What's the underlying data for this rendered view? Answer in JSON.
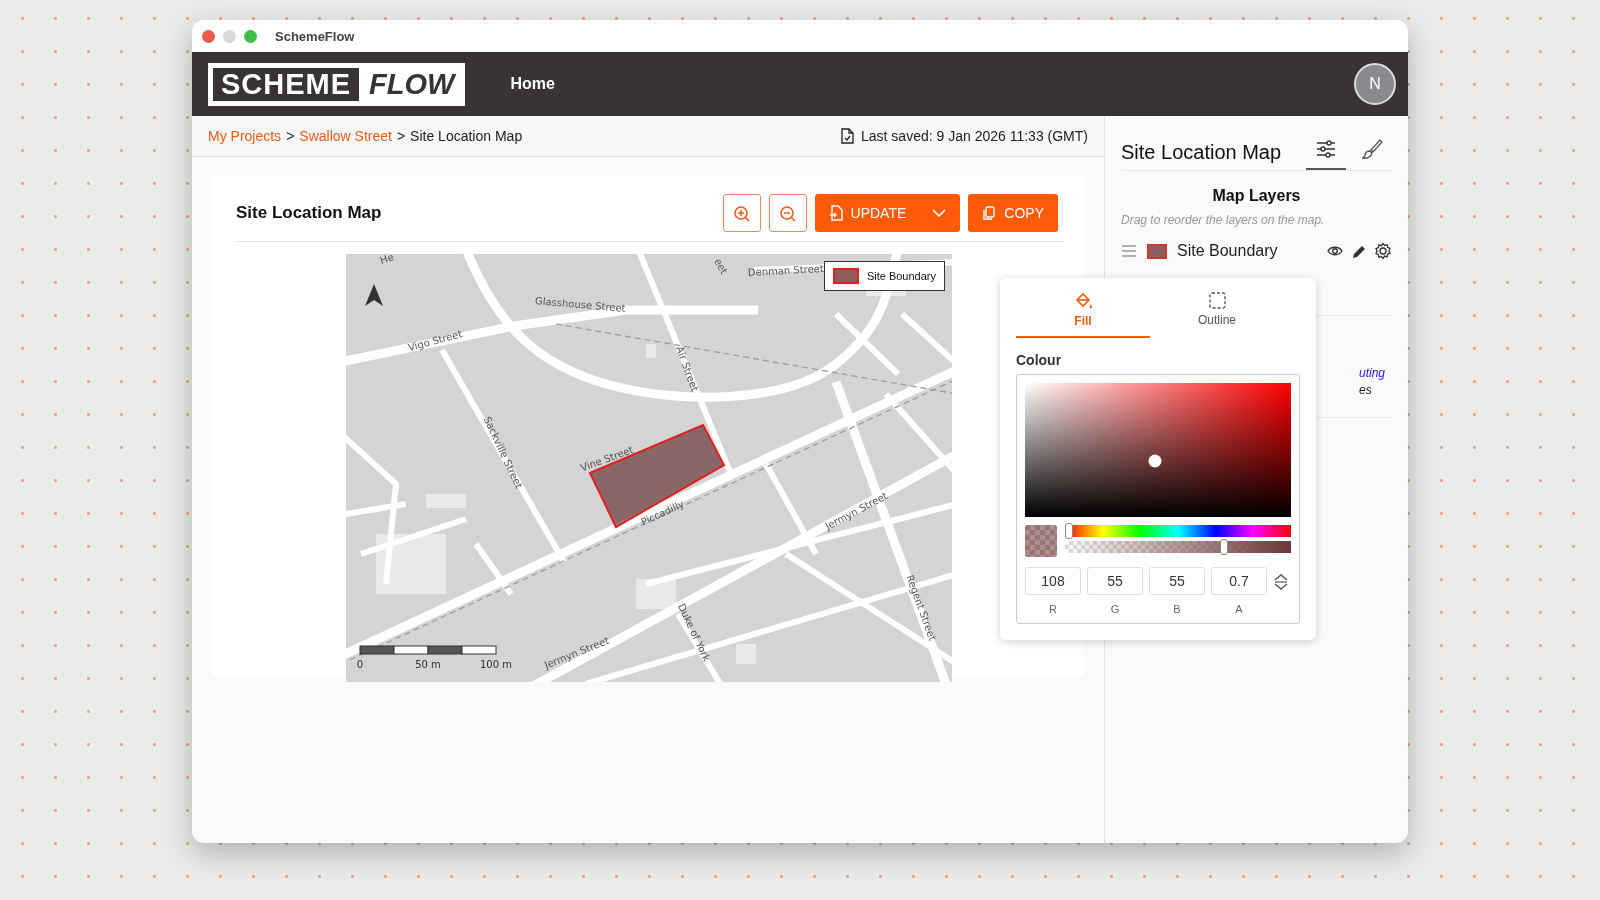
{
  "window": {
    "title": "SchemeFlow"
  },
  "header": {
    "logo": [
      "SCHEME",
      "FLOW"
    ],
    "nav": [
      "Home"
    ],
    "avatar": "N"
  },
  "breadcrumb": [
    {
      "text": "My Projects",
      "kind": "link"
    },
    {
      "text": ">",
      "kind": "separator"
    },
    {
      "text": "Swallow Street",
      "kind": "link"
    },
    {
      "text": ">",
      "kind": "separator"
    },
    {
      "text": "Site Location Map",
      "kind": "current"
    }
  ],
  "last_saved": "Last saved: 9 Jan 2026 11:33 (GMT)",
  "card": {
    "title": "Site Location Map",
    "toolbar": [
      {
        "kind": "zoom-in"
      },
      {
        "kind": "zoom-out"
      },
      {
        "kind": "update",
        "label": "UPDATE"
      },
      {
        "kind": "copy",
        "label": "COPY"
      }
    ]
  },
  "map": {
    "streets": [
      "Glasshouse Street",
      "Vigo Street",
      "Air Street",
      "Sackville Street",
      "Vine Street",
      "Piccadilly",
      "Jermyn Street",
      "Jermyn Street",
      "Duke of York",
      "Regent Street",
      "Denman Street",
      "He",
      "eet"
    ],
    "legend": "Site Boundary",
    "scale": [
      "0",
      "50 m",
      "100 m"
    ]
  },
  "panel": {
    "title": "Site Location Map",
    "tabs": [
      {
        "kind": "sliders",
        "selected": true
      },
      {
        "kind": "brush",
        "selected": false
      }
    ],
    "section": "Map Layers",
    "hint": "Drag to reorder the layers on the map.",
    "layers": [
      {
        "name": "Site Boundary"
      }
    ],
    "partial_texts": [
      {
        "text": "uting",
        "kind": "link"
      },
      {
        "text": "es",
        "kind": "plain"
      }
    ]
  },
  "popover": {
    "tabs": [
      {
        "label": "Fill",
        "kind": "fill",
        "selected": true
      },
      {
        "label": "Outline",
        "kind": "outline",
        "selected": false
      }
    ],
    "section": "Colour",
    "sliders": [
      {
        "kind": "hue",
        "level": 0
      },
      {
        "kind": "alpha",
        "level": 0.7
      }
    ],
    "fields": [
      {
        "value": "108",
        "label": "R"
      },
      {
        "value": "55",
        "label": "G"
      },
      {
        "value": "55",
        "label": "B"
      },
      {
        "value": "0.7",
        "label": "A"
      }
    ]
  }
}
